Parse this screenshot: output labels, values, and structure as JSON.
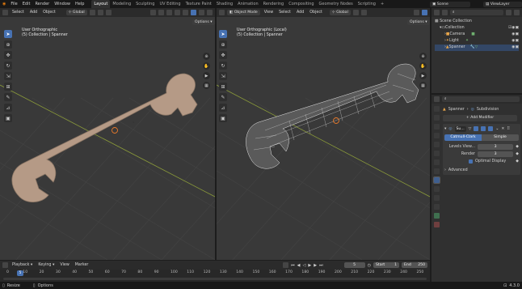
{
  "top_menu": [
    "File",
    "Edit",
    "Render",
    "Window",
    "Help"
  ],
  "workspaces": [
    "Layout",
    "Modeling",
    "Sculpting",
    "UV Editing",
    "Texture Paint",
    "Shading",
    "Animation",
    "Rendering",
    "Compositing",
    "Geometry Nodes",
    "Scripting"
  ],
  "active_workspace": "Layout",
  "scene_name": "Scene",
  "view_layer": "ViewLayer",
  "viewport_left": {
    "menus": [
      "Select",
      "Add",
      "Object"
    ],
    "orientation": "Global",
    "view_name": "User Orthographic",
    "collection_path": "(5) Collection | Spanner",
    "options": "Options"
  },
  "viewport_right": {
    "mode": "Object Mode",
    "menus": [
      "View",
      "Select",
      "Add",
      "Object"
    ],
    "orientation": "Global",
    "view_name": "User Orthographic (Local)",
    "collection_path": "(5) Collection | Spanner",
    "options": "Options"
  },
  "outliner": {
    "search_placeholder": "",
    "root": "Scene Collection",
    "collection": "Collection",
    "items": [
      "Camera",
      "Light",
      "Spanner"
    ]
  },
  "properties": {
    "object": "Spanner",
    "modifier_tab": "Subdivision",
    "add_modifier": "Add Modifier",
    "modifier_name": "Su...",
    "methods": [
      "Catmull-Clark",
      "Simple"
    ],
    "active_method": "Catmull-Clark",
    "levels_label": "Levels View...",
    "levels_value": "3",
    "render_label": "Render",
    "render_value": "3",
    "optimal_display": "Optimal Display",
    "advanced": "Advanced"
  },
  "timeline": {
    "menus": [
      "Playback",
      "Keying",
      "View",
      "Marker"
    ],
    "current_frame": "5",
    "start_label": "Start",
    "start_value": "1",
    "end_label": "End",
    "end_value": "250",
    "ticks": [
      "0",
      "10",
      "20",
      "30",
      "40",
      "50",
      "60",
      "70",
      "80",
      "90",
      "100",
      "110",
      "120",
      "130",
      "140",
      "150",
      "160",
      "170",
      "180",
      "190",
      "200",
      "210",
      "220",
      "230",
      "240",
      "250"
    ],
    "playhead_label": "5"
  },
  "status": {
    "left": "Resize",
    "mid": "Options",
    "version": "4.3.0"
  },
  "colors": {
    "accent": "#4772b3",
    "wrench": "#b59a86",
    "origin": "#e8792a"
  }
}
